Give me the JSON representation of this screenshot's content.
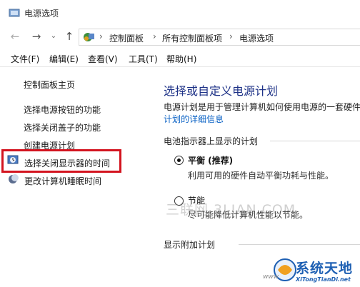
{
  "window": {
    "title": "电源选项"
  },
  "address": {
    "back_glyph": "←",
    "forward_glyph": "→",
    "dropdown_glyph": "⌄",
    "up_glyph": "↑",
    "separator": "›",
    "crumbs": [
      "控制面板",
      "所有控制面板项",
      "电源选项"
    ]
  },
  "menu": [
    "文件(F)",
    "编辑(E)",
    "查看(V)",
    "工具(T)",
    "帮助(H)"
  ],
  "left_pane": {
    "home": "控制面板主页",
    "links": [
      "选择电源按钮的功能",
      "选择关闭盖子的功能",
      "创建电源计划",
      "选择关闭显示器的时间",
      "更改计算机睡眠时间"
    ]
  },
  "main": {
    "heading": "选择或自定义电源计划",
    "description": "电源计划是用于管理计算机如何使用电源的一套硬件",
    "details_link": "计划的详细信息",
    "battery_section": "电池指示器上显示的计划",
    "plans": [
      {
        "name": "平衡 (推荐)",
        "desc": "利用可用的硬件自动平衡功耗与性能。",
        "selected": true
      },
      {
        "name": "节能",
        "desc": "尽可能降低计算机性能以节能。",
        "selected": false
      }
    ],
    "extra_section": "显示附加计划"
  },
  "watermarks": {
    "center": "三联网 3LIAN.COM",
    "brand": "系统天地",
    "site": "XiTongTianDi.net",
    "small": "www"
  },
  "colors": {
    "heading": "#1e3287",
    "link": "#0a62c5",
    "highlight": "#d3141f",
    "brand": "#1d5fb3"
  }
}
